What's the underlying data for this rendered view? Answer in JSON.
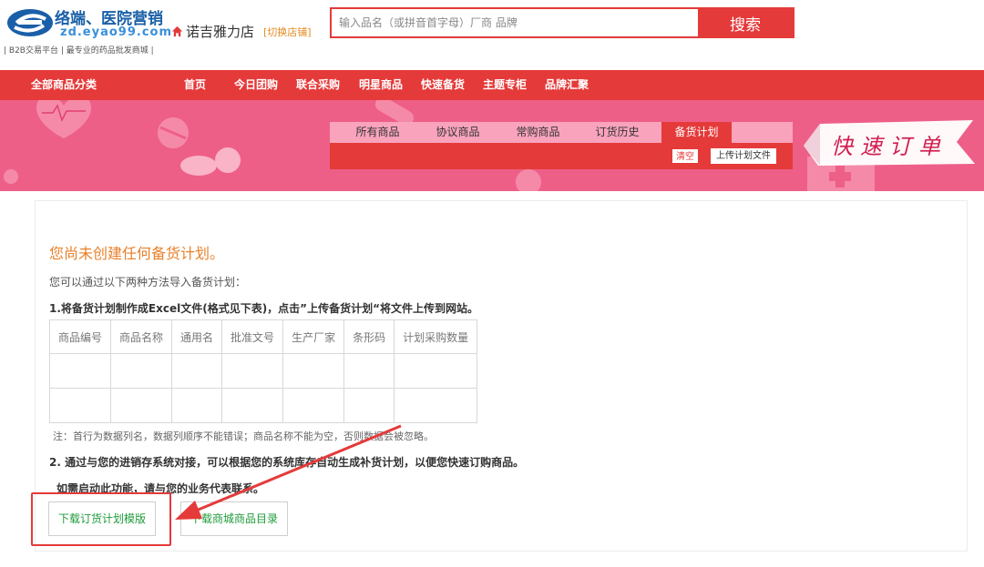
{
  "header": {
    "logo_title": "络端、医院营销",
    "logo_domain": "zd.eyao99.com",
    "logo_tagline": "| B2B交易平台 | 最专业的药品批发商城 |",
    "store_name": "诺吉雅力店",
    "switch_store": "[切换店铺]",
    "search_placeholder": "输入品名（或拼音首字母）厂商 品牌",
    "search_button": "搜索"
  },
  "nav": {
    "all_categories": "全部商品分类",
    "items": [
      "首页",
      "今日团购",
      "联合采购",
      "明星商品",
      "快速备货",
      "主题专柜",
      "品牌汇聚"
    ]
  },
  "banner": {
    "tabs": [
      "所有商品",
      "协议商品",
      "常购商品",
      "订货历史",
      "备货计划"
    ],
    "active_tab": "备货计划",
    "clear_button": "清空",
    "upload_button": "上传计划文件",
    "quick_order": "快速订单"
  },
  "content": {
    "empty_title": "您尚未创建任何备货计划。",
    "intro": "您可以通过以下两种方法导入备货计划：",
    "step1": "1.将备货计划制作成Excel文件(格式见下表)，点击”上传备货计划“将文件上传到网站。",
    "table_headers": [
      "商品编号",
      "商品名称",
      "通用名",
      "批准文号",
      "生产厂家",
      "条形码",
      "计划采购数量"
    ],
    "note": "注：首行为数据列名，数据列顺序不能错误；商品名称不能为空，否则数据会被忽略。",
    "step2": "2. 通过与您的进销存系统对接，可以根据您的系统库存自动生成补货计划，以便您快速订购商品。",
    "step2_sub": "如需启动此功能，请与您的业务代表联系。",
    "download_template": "下载订货计划模版",
    "download_catalog": "下载商城商品目录"
  },
  "colors": {
    "primary_red": "#e53a3a",
    "banner_pink": "#ee5f88",
    "title_orange": "#e8812a",
    "link_green": "#1e9b3a"
  }
}
